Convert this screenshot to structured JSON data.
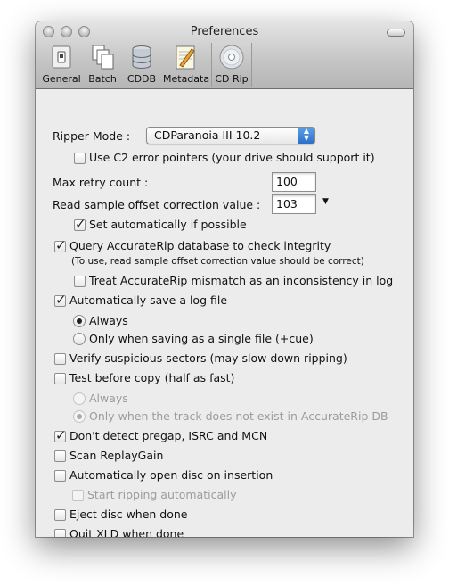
{
  "window": {
    "title": "Preferences"
  },
  "toolbar": {
    "items": [
      {
        "label": "General",
        "icon": "general-switch-icon"
      },
      {
        "label": "Batch",
        "icon": "batch-documents-icon"
      },
      {
        "label": "CDDB",
        "icon": "cddb-database-icon"
      },
      {
        "label": "Metadata",
        "icon": "metadata-pencil-icon"
      },
      {
        "label": "CD Rip",
        "icon": "cd-disc-icon"
      }
    ],
    "selected": "CD Rip"
  },
  "form": {
    "ripper_mode_label": "Ripper Mode :",
    "ripper_mode_value": "CDParanoia III 10.2",
    "c2_label": "Use C2 error pointers (your drive should support it)",
    "c2_checked": false,
    "max_retry_label": "Max retry count :",
    "max_retry_value": "100",
    "offset_label": "Read sample offset correction value :",
    "offset_value": "103",
    "set_auto_label": "Set automatically if possible",
    "set_auto_checked": true,
    "accuraterip_label": "Query AccurateRip database to check integrity",
    "accuraterip_checked": true,
    "accuraterip_note": "(To use, read sample offset correction value should be correct)",
    "treat_mismatch_label": "Treat AccurateRip mismatch as an inconsistency in log",
    "treat_mismatch_checked": false,
    "auto_log_label": "Automatically save a log file",
    "auto_log_checked": true,
    "log_always_label": "Always",
    "log_single_label": "Only when saving as a single file (+cue)",
    "verify_label": "Verify suspicious sectors (may slow down ripping)",
    "verify_checked": false,
    "test_copy_label": "Test before copy (half as fast)",
    "test_copy_checked": false,
    "test_always_label": "Always",
    "test_only_label": "Only when the track does not exist in AccurateRip DB",
    "pregap_label": "Don't detect pregap, ISRC and MCN",
    "pregap_checked": true,
    "replaygain_label": "Scan ReplayGain",
    "replaygain_checked": false,
    "auto_open_label": "Automatically open disc on insertion",
    "auto_open_checked": false,
    "start_ripping_label": "Start ripping automatically",
    "start_ripping_checked": false,
    "eject_label": "Eject disc when done",
    "eject_checked": false,
    "quit_label": "Quit XLD when done",
    "quit_checked": false
  }
}
